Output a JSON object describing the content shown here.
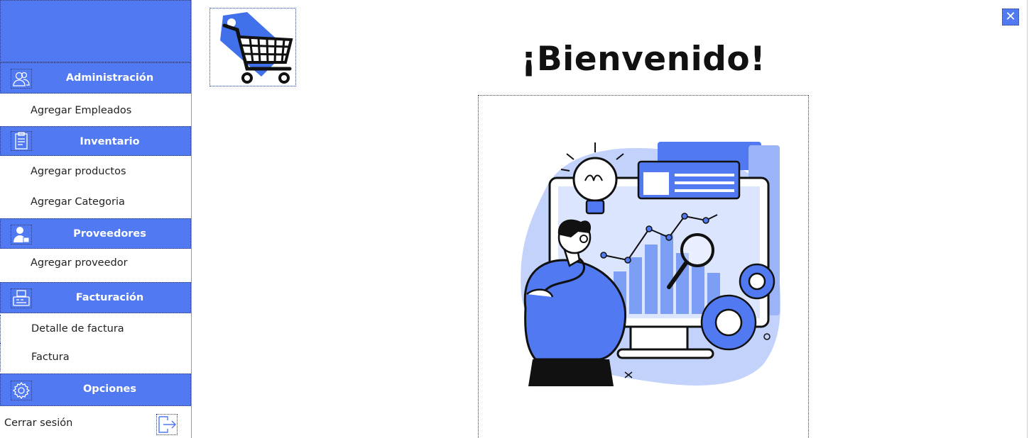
{
  "colors": {
    "accent": "#5079f2",
    "illustration_light": "#c3d2fb",
    "dark": "#111111"
  },
  "sidebar": {
    "sections": [
      {
        "label": "Administración",
        "icon": "users-icon",
        "items": [
          "Agregar Empleados"
        ]
      },
      {
        "label": "Inventario",
        "icon": "clipboard-icon",
        "items": [
          "Agregar productos",
          "Agregar Categoria"
        ]
      },
      {
        "label": "Proveedores",
        "icon": "supplier-icon",
        "items": [
          "Agregar proveedor"
        ]
      },
      {
        "label": "Facturación",
        "icon": "cash-register-icon",
        "items": [
          "Detalle de factura",
          "Factura"
        ]
      },
      {
        "label": "Opciones",
        "icon": "gear-icon",
        "items": []
      }
    ],
    "logout_label": "Cerrar sesión"
  },
  "main": {
    "welcome": "¡Bienvenido!",
    "close_symbol": "✕"
  }
}
